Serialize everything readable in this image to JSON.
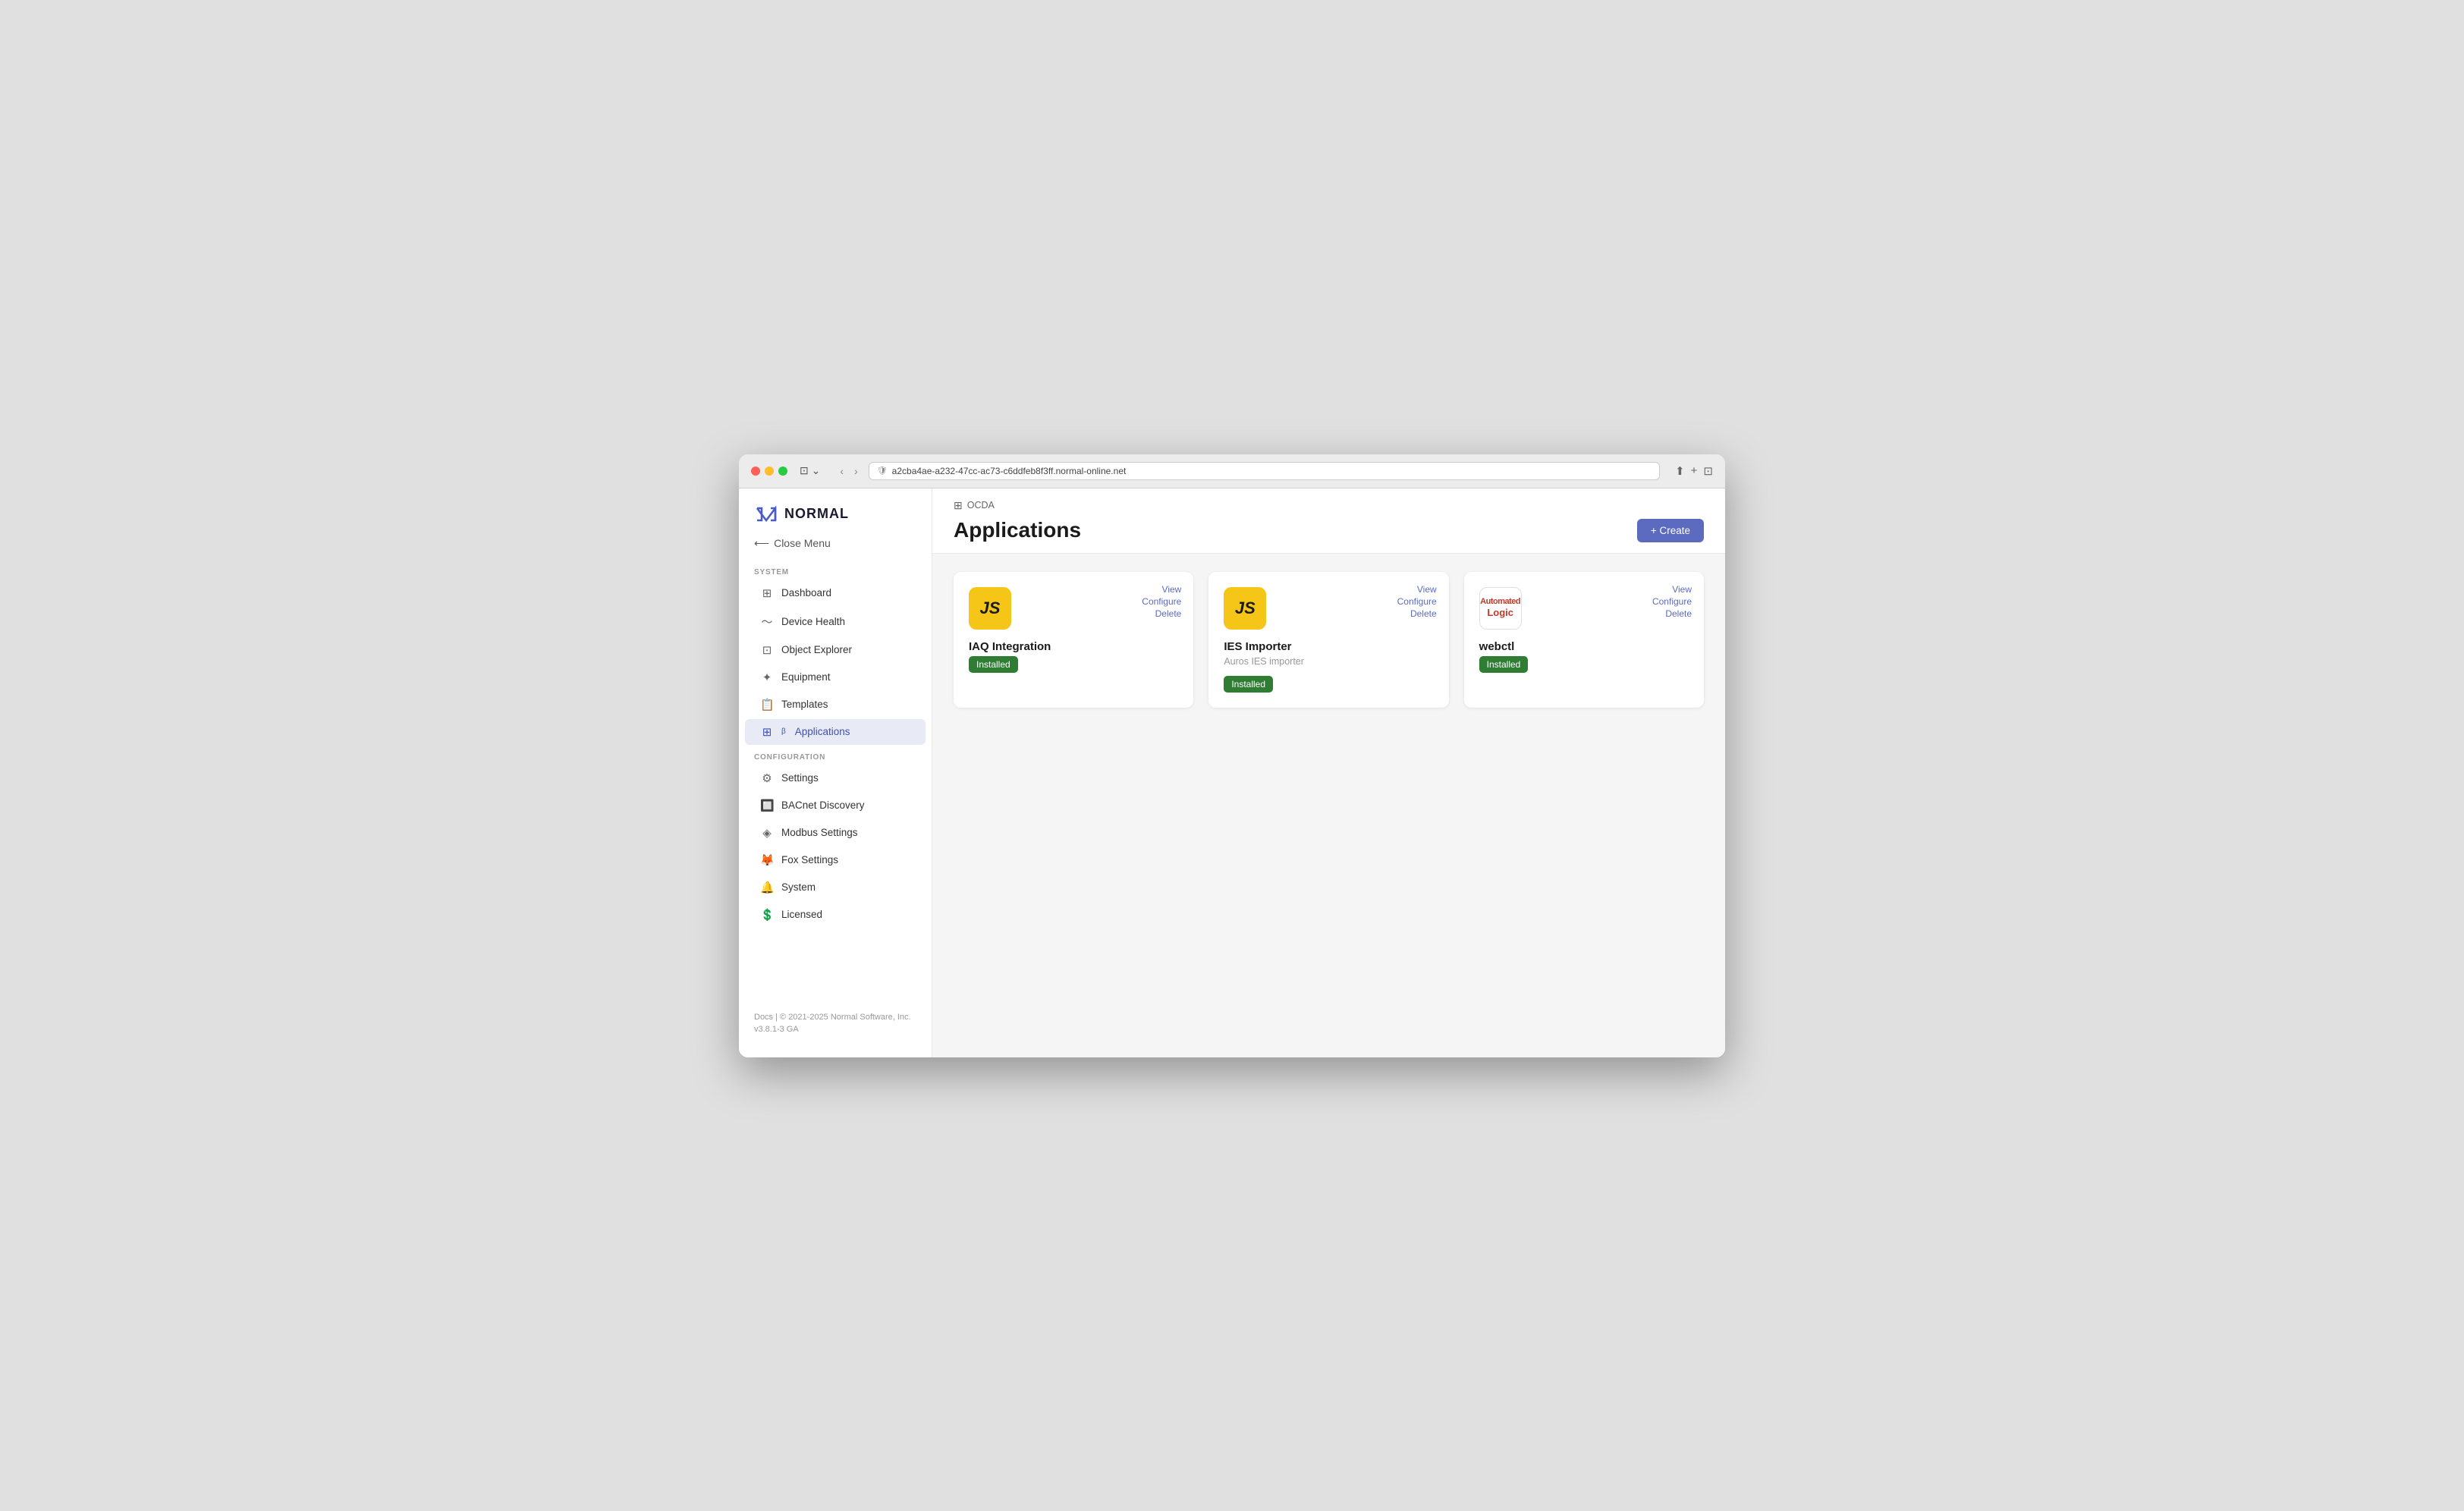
{
  "browser": {
    "url": "a2cba4ae-a232-47cc-ac73-c6ddfeb8f3ff.normal-online.net",
    "refresh_icon": "↺"
  },
  "sidebar": {
    "logo_text": "NORMAL",
    "close_menu_label": "Close Menu",
    "system_label": "SYSTEM",
    "config_label": "CONFIGURATION",
    "items_system": [
      {
        "id": "dashboard",
        "label": "Dashboard",
        "icon": "⊞"
      },
      {
        "id": "device-health",
        "label": "Device Health",
        "icon": "〜"
      },
      {
        "id": "object-explorer",
        "label": "Object Explorer",
        "icon": "⊡"
      },
      {
        "id": "equipment",
        "label": "Equipment",
        "icon": "✦"
      },
      {
        "id": "templates",
        "label": "Templates",
        "icon": "📄"
      },
      {
        "id": "applications",
        "label": "Applications",
        "icon": "⊞",
        "beta": true,
        "active": true
      }
    ],
    "items_config": [
      {
        "id": "settings",
        "label": "Settings",
        "icon": "⚙"
      },
      {
        "id": "bacnet-discovery",
        "label": "BACnet Discovery",
        "icon": "🔲"
      },
      {
        "id": "modbus-settings",
        "label": "Modbus Settings",
        "icon": "◈"
      },
      {
        "id": "fox-settings",
        "label": "Fox Settings",
        "icon": "🦊"
      },
      {
        "id": "system",
        "label": "System",
        "icon": "🔔"
      },
      {
        "id": "licensed",
        "label": "Licensed",
        "icon": "💲"
      }
    ],
    "footer_text": "Docs | © 2021-2025 Normal Software, Inc.",
    "footer_version": "v3.8.1-3 GA"
  },
  "main": {
    "breadcrumb_icon": "⊞",
    "breadcrumb_label": "OCDA",
    "page_title": "Applications",
    "create_button_label": "+ Create",
    "apps": [
      {
        "id": "iaq-integration",
        "logo_type": "js",
        "title": "IAQ Integration",
        "description": "",
        "status": "Installed",
        "actions": [
          "View",
          "Configure",
          "Delete"
        ]
      },
      {
        "id": "ies-importer",
        "logo_type": "js",
        "title": "IES Importer",
        "description": "Auros IES importer",
        "status": "Installed",
        "actions": [
          "View",
          "Configure",
          "Delete"
        ]
      },
      {
        "id": "webctl",
        "logo_type": "automated-logic",
        "title": "webctl",
        "description": "",
        "status": "Installed",
        "actions": [
          "View",
          "Configure",
          "Delete"
        ]
      }
    ]
  }
}
